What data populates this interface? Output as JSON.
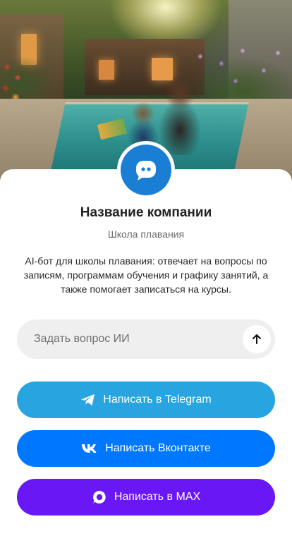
{
  "company": {
    "name": "Название компании",
    "subtitle": "Школа плавания",
    "description": "AI-бот для школы плавания: отвечает на вопросы по записям, программам обучения и графику занятий, а также помогает записаться на курсы."
  },
  "ask": {
    "placeholder": "Задать вопрос ИИ",
    "value": ""
  },
  "buttons": {
    "telegram": "Написать в Telegram",
    "vk": "Написать Вконтакте",
    "max": "Написать в MAX"
  },
  "icons": {
    "avatar": "chat-bubble-icon",
    "send": "arrow-up-icon",
    "telegram": "telegram-icon",
    "vk": "vk-icon",
    "max": "max-icon"
  },
  "colors": {
    "avatar": "#1a7fd4",
    "telegram": "#28a5e1",
    "vk": "#0077ff",
    "max": "#6a17f5"
  }
}
